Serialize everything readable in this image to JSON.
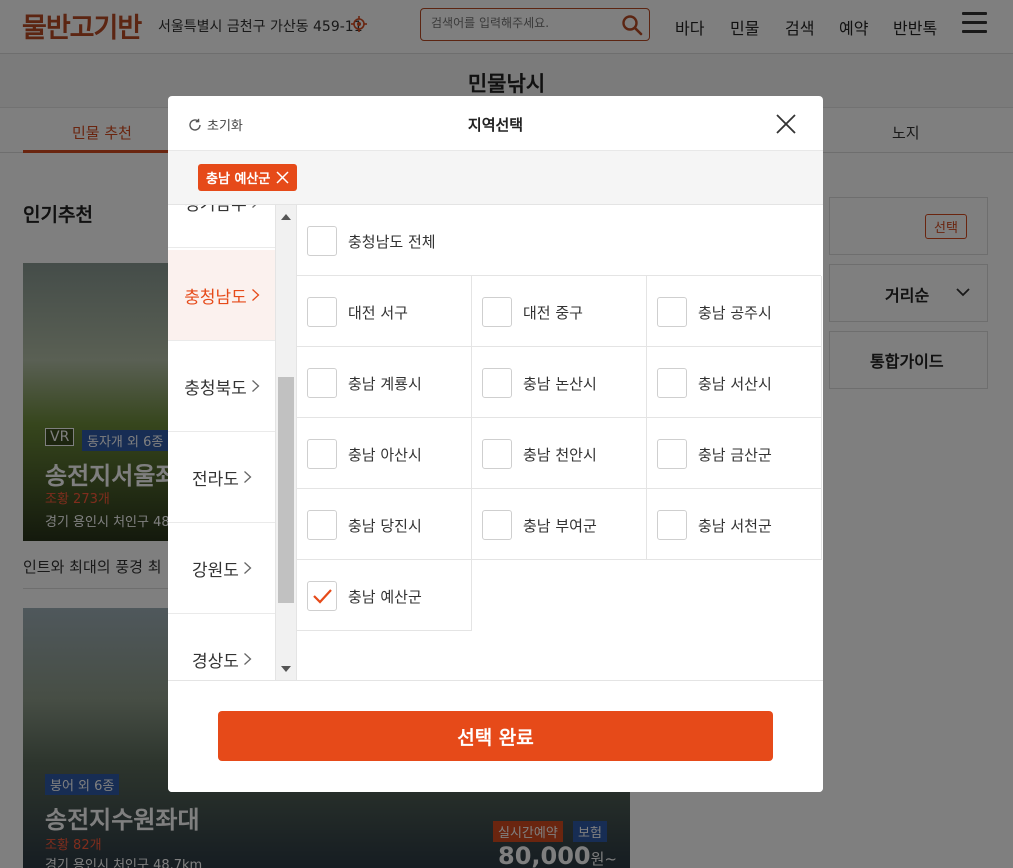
{
  "header": {
    "logo": "물반고기반",
    "location": "서울특별시 금천구 가산동 459-11",
    "search_placeholder": "검색어를 입력해주세요.",
    "nav": [
      "바다",
      "민물",
      "검색",
      "예약",
      "반반톡"
    ]
  },
  "page": {
    "title": "민물낚시",
    "tabs": [
      "민물 추천",
      "노지"
    ],
    "section_title": "인기추천"
  },
  "cards": [
    {
      "vr": "VR",
      "fish": "동자개 외 6종",
      "name": "송전지서울좌",
      "catch": "조황 273개",
      "addr": "경기 용인시 처인구 48",
      "desc": "인트와 최대의 풍경 최"
    },
    {
      "fish": "붕어 외 6종",
      "name": "송전지수원좌대",
      "catch": "조황 82개",
      "addr": "경기 용인시 처인구 48.7km",
      "live": "실시간예약",
      "insurance": "보험",
      "price": "80,000",
      "price_unit": "원~"
    }
  ],
  "sidebar_right": {
    "select": "선택",
    "sort": "거리순",
    "guide": "통합가이드"
  },
  "modal": {
    "reset": "초기화",
    "title": "지역선택",
    "selected_chip": "충남 예산군",
    "provinces": [
      {
        "label": "경기남부"
      },
      {
        "label": "충청남도"
      },
      {
        "label": "충청북도"
      },
      {
        "label": "전라도"
      },
      {
        "label": "강원도"
      },
      {
        "label": "경상도"
      }
    ],
    "active_province": "충청남도",
    "all_label": "충청남도 전체",
    "regions": [
      {
        "label": "대전 서구",
        "checked": false
      },
      {
        "label": "대전 중구",
        "checked": false
      },
      {
        "label": "충남 공주시",
        "checked": false
      },
      {
        "label": "충남 계룡시",
        "checked": false
      },
      {
        "label": "충남 논산시",
        "checked": false
      },
      {
        "label": "충남 서산시",
        "checked": false
      },
      {
        "label": "충남 아산시",
        "checked": false
      },
      {
        "label": "충남 천안시",
        "checked": false
      },
      {
        "label": "충남 금산군",
        "checked": false
      },
      {
        "label": "충남 당진시",
        "checked": false
      },
      {
        "label": "충남 부여군",
        "checked": false
      },
      {
        "label": "충남 서천군",
        "checked": false
      },
      {
        "label": "충남 예산군",
        "checked": true
      }
    ],
    "done": "선택 완료"
  },
  "colors": {
    "accent": "#e64a19",
    "brand": "#b84a25",
    "badge_blue": "#2f5aa8"
  }
}
